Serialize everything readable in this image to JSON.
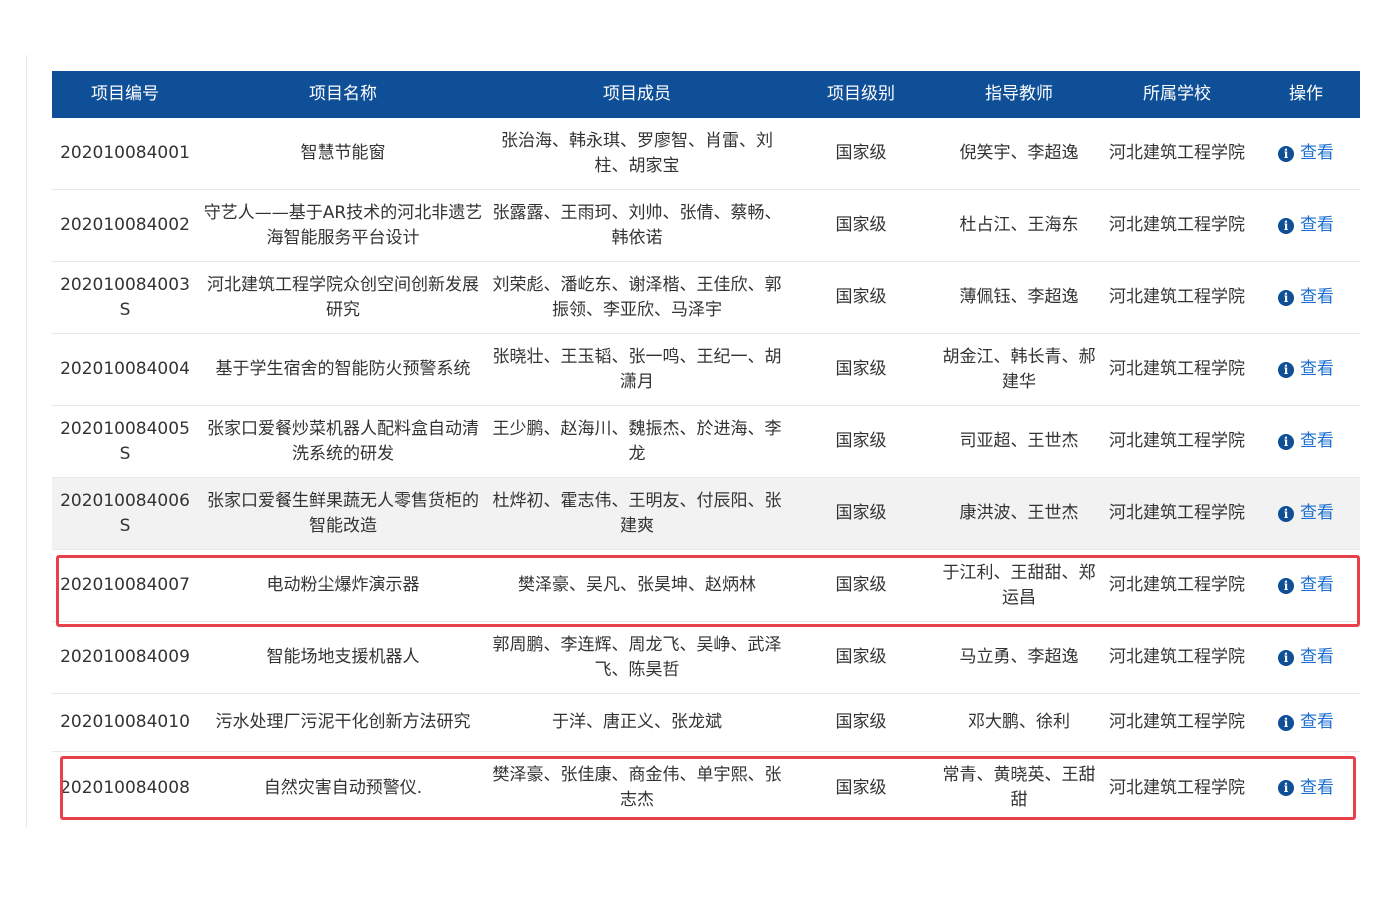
{
  "table": {
    "headers": [
      "项目编号",
      "项目名称",
      "项目成员",
      "项目级别",
      "指导教师",
      "所属学校",
      "操作"
    ],
    "view_label": "查看",
    "rows": [
      {
        "id": "202010084001",
        "name": "智慧节能窗",
        "members": "张治海、韩永琪、罗廖智、肖雷、刘柱、胡家宝",
        "level": "国家级",
        "teachers": "倪笑宇、李超逸",
        "school": "河北建筑工程学院"
      },
      {
        "id": "202010084002",
        "name": "守艺人——基于AR技术的河北非遗艺海智能服务平台设计",
        "members": "张露露、王雨珂、刘帅、张倩、蔡畅、韩依诺",
        "level": "国家级",
        "teachers": "杜占江、王海东",
        "school": "河北建筑工程学院"
      },
      {
        "id": "202010084003S",
        "name": "河北建筑工程学院众创空间创新发展研究",
        "members": "刘荣彪、潘屹东、谢泽楷、王佳欣、郭振领、李亚欣、马泽宇",
        "level": "国家级",
        "teachers": "薄佩钰、李超逸",
        "school": "河北建筑工程学院"
      },
      {
        "id": "202010084004",
        "name": "基于学生宿舍的智能防火预警系统",
        "members": "张晓壮、王玉韬、张一鸣、王纪一、胡潇月",
        "level": "国家级",
        "teachers": "胡金江、韩长青、郝建华",
        "school": "河北建筑工程学院"
      },
      {
        "id": "202010084005S",
        "name": "张家口爱餐炒菜机器人配料盒自动清洗系统的研发",
        "members": "王少鹏、赵海川、魏振杰、於进海、李龙",
        "level": "国家级",
        "teachers": "司亚超、王世杰",
        "school": "河北建筑工程学院"
      },
      {
        "id": "202010084006S",
        "name": "张家口爱餐生鲜果蔬无人零售货柜的智能改造",
        "members": "杜烨初、霍志伟、王明友、付辰阳、张建爽",
        "level": "国家级",
        "teachers": "康洪波、王世杰",
        "school": "河北建筑工程学院"
      },
      {
        "id": "202010084007",
        "name": "电动粉尘爆炸演示器",
        "members": "樊泽豪、吴凡、张昊坤、赵炳林",
        "level": "国家级",
        "teachers": "于江利、王甜甜、郑运昌",
        "school": "河北建筑工程学院"
      },
      {
        "id": "202010084009",
        "name": "智能场地支援机器人",
        "members": "郭周鹏、李连辉、周龙飞、吴峥、武泽飞、陈昊哲",
        "level": "国家级",
        "teachers": "马立勇、李超逸",
        "school": "河北建筑工程学院"
      },
      {
        "id": "202010084010",
        "name": "污水处理厂污泥干化创新方法研究",
        "members": "于洋、唐正义、张龙斌",
        "level": "国家级",
        "teachers": "邓大鹏、徐利",
        "school": "河北建筑工程学院"
      },
      {
        "id": "202010084008",
        "name": "自然灾害自动预警仪.",
        "members": "樊泽豪、张佳康、商金伟、单宇熙、张志杰",
        "level": "国家级",
        "teachers": "常青、黄晓英、王甜甜",
        "school": "河北建筑工程学院"
      }
    ]
  },
  "colors": {
    "header_bg": "#0f4f97",
    "link": "#1c6fd1",
    "highlight_border": "#e8414c",
    "shaded_row": "#f2f2f2"
  },
  "icons": {
    "view": "info-circle-icon"
  }
}
